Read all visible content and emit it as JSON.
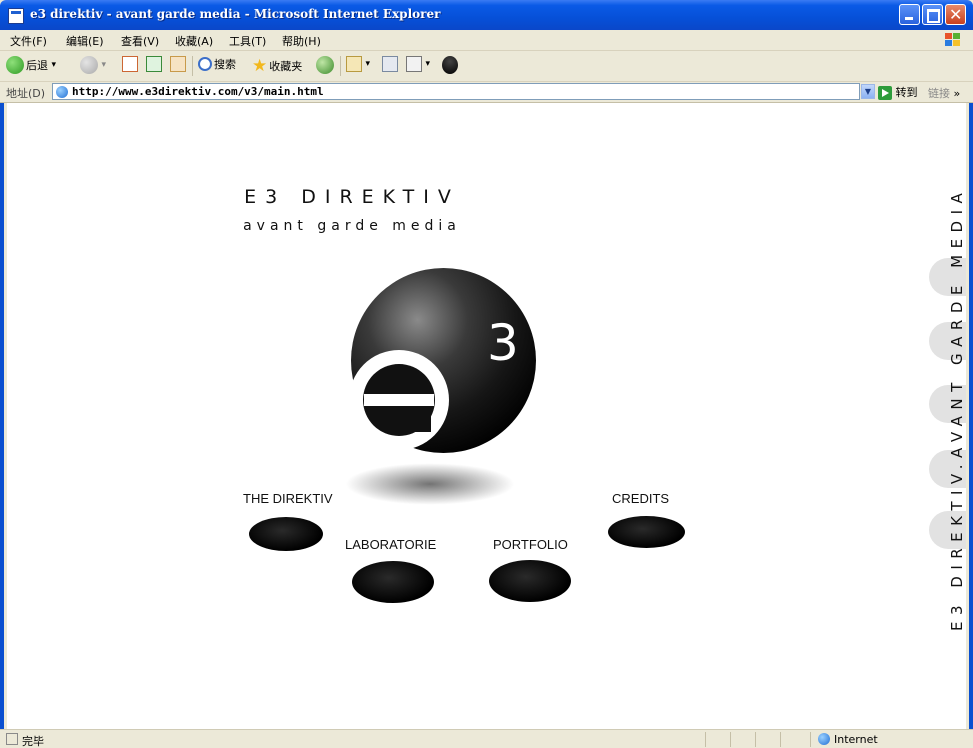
{
  "window": {
    "title": "e3 direktiv - avant garde media - Microsoft Internet Explorer"
  },
  "menu": {
    "items": [
      "文件(F)",
      "编辑(E)",
      "查看(V)",
      "收藏(A)",
      "工具(T)",
      "帮助(H)"
    ]
  },
  "toolbar": {
    "back_label": "后退",
    "search_label": "搜索",
    "favorites_label": "收藏夹"
  },
  "address": {
    "label": "地址(D)",
    "url": "http://www.e3direktiv.com/v3/main.html",
    "go_label": "转到",
    "links_label": "链接"
  },
  "page": {
    "brand_title": "E3 DIREKTIV",
    "brand_subtitle": "avant garde media",
    "logo_superscript": "3",
    "nav": {
      "the_direktiv": "THE DIREKTIV",
      "laboratorie": "LABORATORIE",
      "portfolio": "PORTFOLIO",
      "credits": "CREDITS"
    },
    "vertical_title": "E3 DIREKTIV.AVANT GARDE MEDIA"
  },
  "status": {
    "text": "完毕",
    "zone": "Internet"
  },
  "colors": {
    "titlebar": "#0a5ae6",
    "chrome": "#ece9d8",
    "page_bg": "#ffffff"
  }
}
